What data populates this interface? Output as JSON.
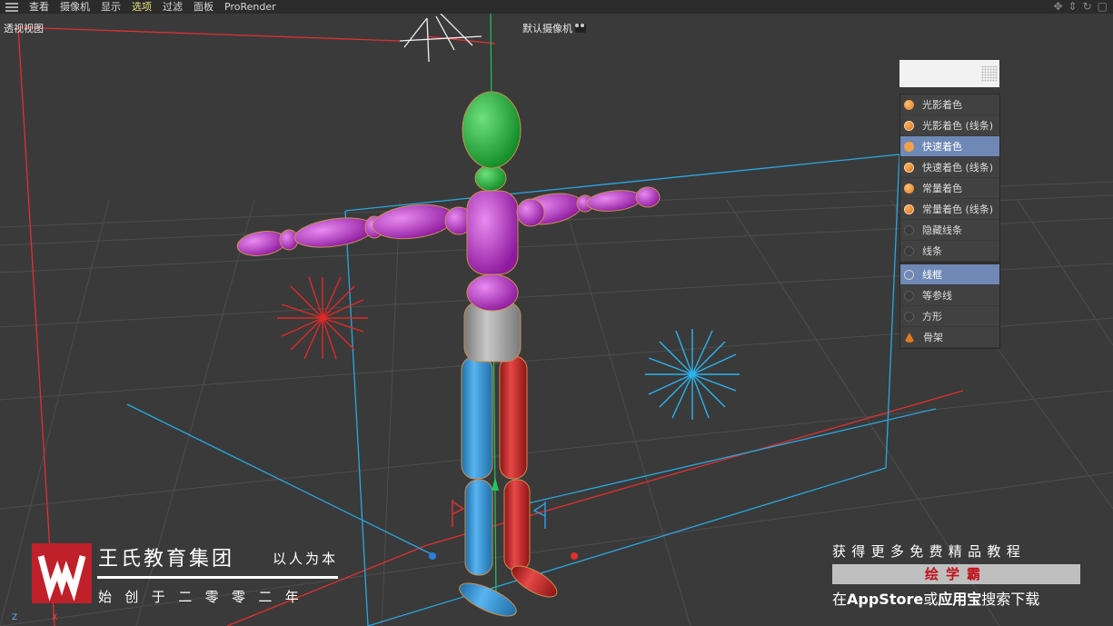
{
  "menubar": {
    "items": [
      "查看",
      "摄像机",
      "显示",
      "选项",
      "过滤",
      "面板",
      "ProRender"
    ],
    "active_index": 3
  },
  "viewport": {
    "label": "透视视图",
    "camera_label": "默认摄像机"
  },
  "display_menu": {
    "items": [
      {
        "label": "光影着色",
        "icon": "sphere-shaded-icon"
      },
      {
        "label": "光影着色 (线条)",
        "icon": "sphere-shaded-lines-icon"
      },
      {
        "label": "快速着色",
        "icon": "sphere-quick-icon",
        "selected": true
      },
      {
        "label": "快速着色 (线条)",
        "icon": "sphere-quick-lines-icon"
      },
      {
        "label": "常量着色",
        "icon": "sphere-constant-icon"
      },
      {
        "label": "常量着色 (线条)",
        "icon": "sphere-constant-lines-icon"
      },
      {
        "label": "隐藏线条",
        "icon": "hidden-lines-icon"
      },
      {
        "label": "线条",
        "icon": "lines-icon"
      }
    ],
    "items2": [
      {
        "label": "线框",
        "icon": "wireframe-icon",
        "selected": true
      },
      {
        "label": "等参线",
        "icon": "isoparm-icon"
      },
      {
        "label": "方形",
        "icon": "box-icon"
      },
      {
        "label": "骨架",
        "icon": "skeleton-icon"
      }
    ]
  },
  "watermark": {
    "brand": "王氏教育集团",
    "slogan": "以人为本",
    "founded": "始创于二零零二年",
    "promo_line1": "获得更多免费精品教程",
    "promo_app": "绘学霸",
    "promo_line3_a": "在",
    "promo_line3_b": "AppStore",
    "promo_line3_c": "或",
    "promo_line3_d": "应用宝",
    "promo_line3_e": "搜索下载"
  },
  "axes": {
    "z": "Z",
    "x": "X"
  },
  "colors": {
    "head": "#1fa33a",
    "torso": "#b234c0",
    "pelvis": "#9a9a9a",
    "left_leg": "#2f8cd0",
    "right_leg": "#c82a2a",
    "menu_selected": "#6f88b5",
    "brand_red": "#c0202a"
  }
}
